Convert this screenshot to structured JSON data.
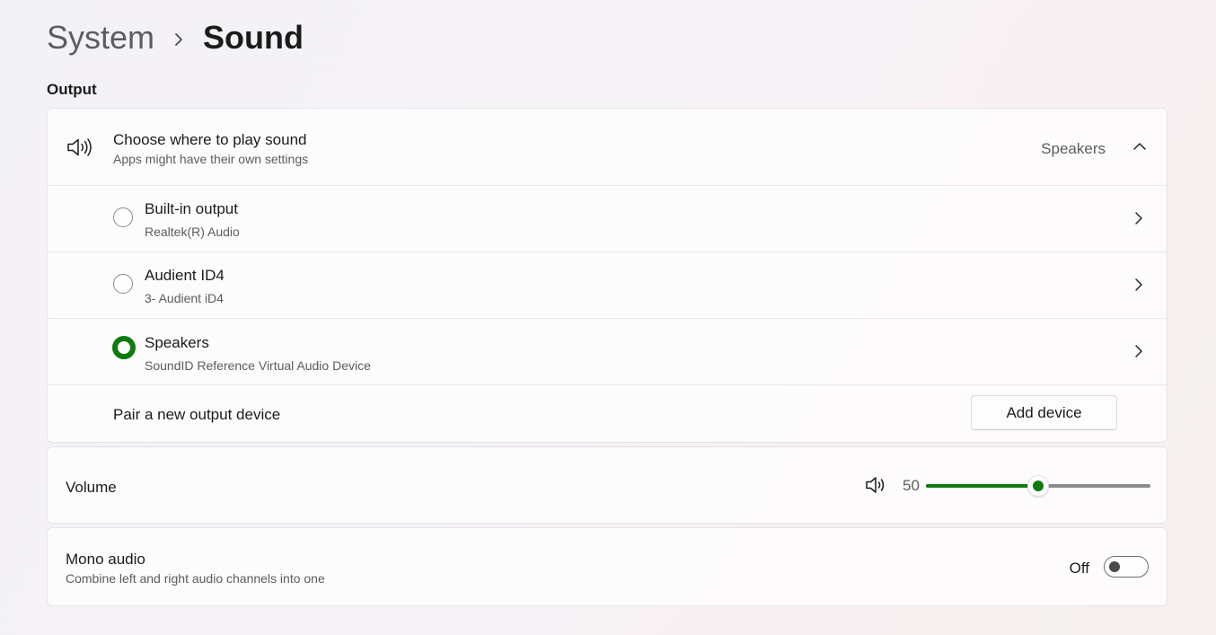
{
  "breadcrumb": {
    "parent": "System",
    "current": "Sound"
  },
  "output": {
    "section_title": "Output",
    "choose": {
      "title": "Choose where to play sound",
      "subtitle": "Apps might have their own settings",
      "selected_value": "Speakers",
      "expanded": true
    },
    "devices": [
      {
        "name": "Built-in output",
        "description": "Realtek(R) Audio",
        "selected": false
      },
      {
        "name": "Audient ID4",
        "description": "3- Audient iD4",
        "selected": false
      },
      {
        "name": "Speakers",
        "description": "SoundID Reference Virtual Audio Device",
        "selected": true
      }
    ],
    "pair": {
      "label": "Pair a new output device",
      "button_label": "Add device"
    }
  },
  "volume": {
    "label": "Volume",
    "value": "50",
    "level": 0.5
  },
  "mono": {
    "title": "Mono audio",
    "subtitle": "Combine left and right audio channels into one",
    "state_label": "Off",
    "on": false
  },
  "colors": {
    "accent": "#0f7b0f",
    "secondary_text": "#5c5c5c"
  },
  "icons": {
    "breadcrumb_separator": "chevron-right-icon",
    "output": "speaker-icon",
    "collapse": "chevron-up-icon",
    "device_arrow": "chevron-right-icon",
    "volume": "volume-icon"
  }
}
